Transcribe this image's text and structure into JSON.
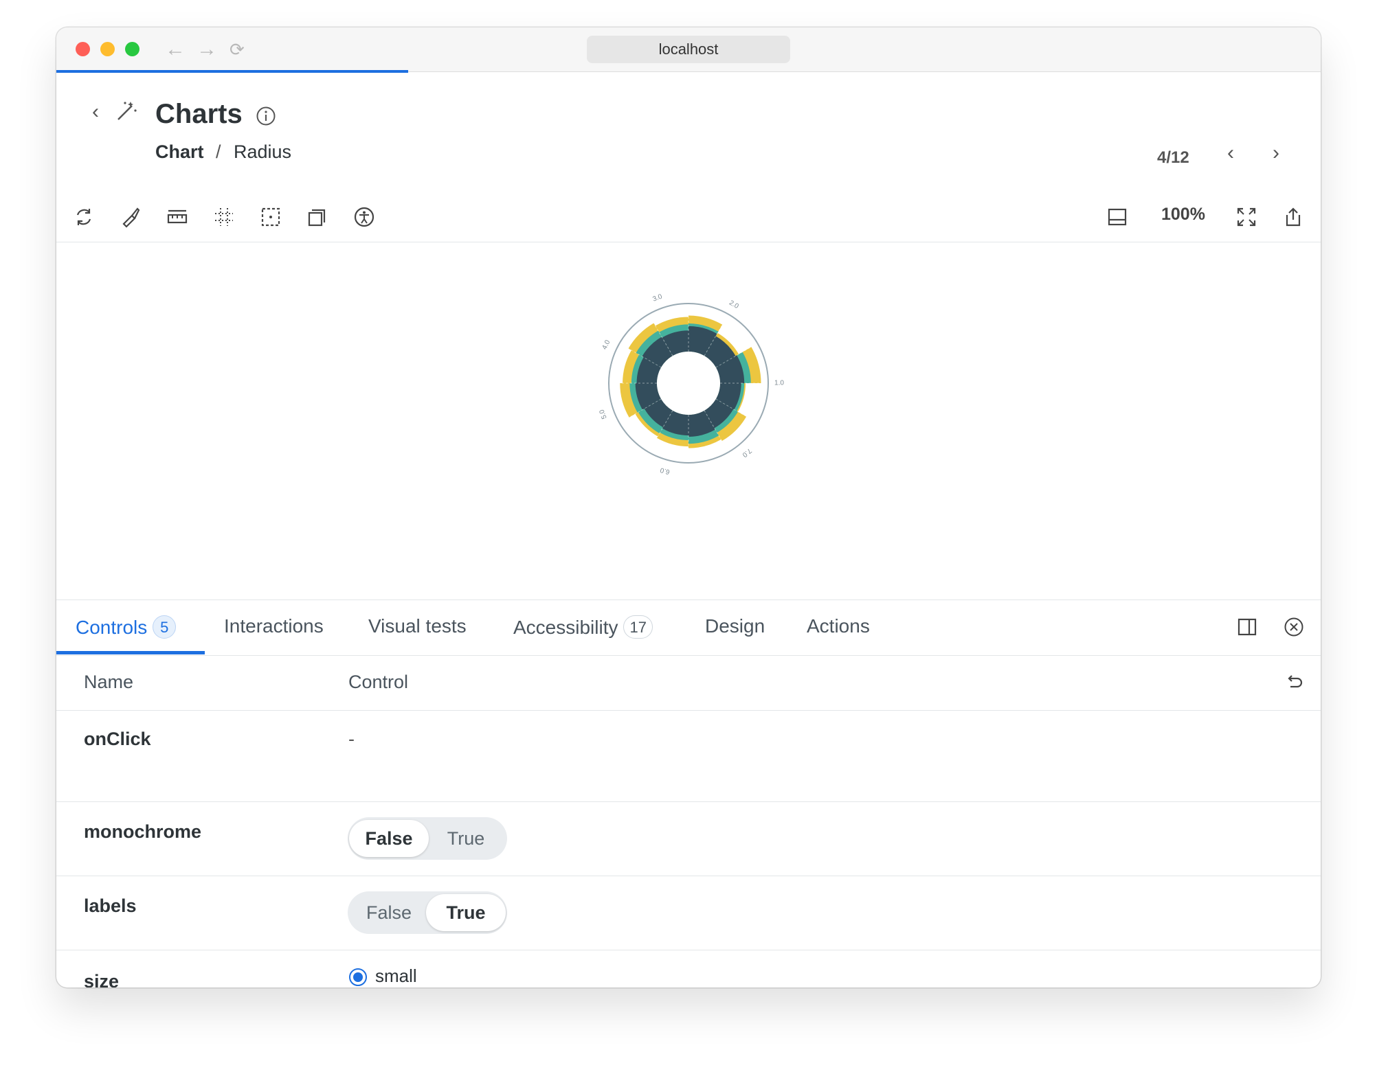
{
  "browser": {
    "address": "localhost"
  },
  "header": {
    "title": "Charts",
    "breadcrumb": [
      "Chart",
      "Radius"
    ],
    "separator": "/",
    "pager": "4/12"
  },
  "toolbar": {
    "zoom": "100%",
    "tools": [
      "reload-icon",
      "brush-icon",
      "ruler-icon",
      "grid-icon",
      "outline-icon",
      "layers-icon",
      "accessibility-icon"
    ],
    "right_tools": [
      "panel-icon",
      "fullscreen-icon",
      "share-icon"
    ]
  },
  "chart_data": {
    "type": "radial-bar",
    "series_colors": [
      "#ecc640",
      "#45b29d",
      "#334d5c"
    ],
    "tick_labels": [
      "1.0",
      "2.0",
      "3.0",
      "4.0",
      "5.0",
      "6.0",
      "7.0"
    ],
    "series": [
      {
        "name": "",
        "color": "#ecc640",
        "values": [
          0.82,
          0.6,
          0.93,
          0.58,
          0.8,
          0.76,
          0.72,
          0.68,
          0.84,
          0.78,
          0.86,
          0.79
        ]
      },
      {
        "name": "",
        "color": "#45b29d",
        "values": [
          0.64,
          0.5,
          0.7,
          0.55,
          0.58,
          0.66,
          0.58,
          0.6,
          0.62,
          0.58,
          0.66,
          0.62
        ]
      },
      {
        "name": "",
        "color": "#334d5c",
        "values": [
          0.58,
          0.52,
          0.55,
          0.48,
          0.46,
          0.5,
          0.47,
          0.44,
          0.49,
          0.46,
          0.5,
          0.48
        ]
      }
    ]
  },
  "panel": {
    "tabs": [
      {
        "label": "Controls",
        "badge": "5"
      },
      {
        "label": "Interactions",
        "badge": ""
      },
      {
        "label": "Visual tests",
        "badge": ""
      },
      {
        "label": "Accessibility",
        "badge": "17"
      },
      {
        "label": "Design",
        "badge": ""
      },
      {
        "label": "Actions",
        "badge": ""
      }
    ],
    "columns": {
      "name": "Name",
      "control": "Control"
    },
    "rows": [
      {
        "name": "onClick",
        "value": "-"
      },
      {
        "name": "monochrome",
        "options": [
          "False",
          "True"
        ],
        "selected": "False"
      },
      {
        "name": "labels",
        "options": [
          "False",
          "True"
        ],
        "selected": "True"
      },
      {
        "name": "size",
        "option": "small",
        "selected": "small"
      }
    ]
  }
}
